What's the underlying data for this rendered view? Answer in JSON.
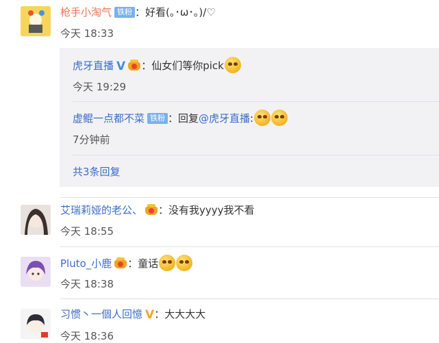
{
  "comments": [
    {
      "name": "枪手小淘气",
      "badge": "铁粉",
      "text": "：好看(｡･ω･｡)/♡",
      "time": "今天 18:33",
      "replies": [
        {
          "name": "虎牙直播",
          "verified": "V",
          "text": "：仙女们等你pick",
          "time": "今天 19:29"
        },
        {
          "name": "虚鲲一点都不菜",
          "badge": "铁粉",
          "text": "：回复",
          "mention": "@虎牙直播",
          "text2": ":",
          "time": "7分钟前"
        }
      ],
      "more_replies": "共3条回复"
    },
    {
      "name": "艾瑞莉娅的老公、",
      "text": "：没有我yyyy我不看",
      "time": "今天 18:55"
    },
    {
      "name": "Pluto_小鹿",
      "text": "：童话",
      "time": "今天 18:38"
    },
    {
      "name": "习惯丶一個人回憶",
      "verified": "V",
      "text": "：大大大大",
      "time": "今天 18:36"
    }
  ],
  "colors": {
    "name": "#eb7350",
    "link": "#3b6cc7",
    "badge": "#7ab1ec",
    "reply_bg": "#f2f2f5"
  }
}
